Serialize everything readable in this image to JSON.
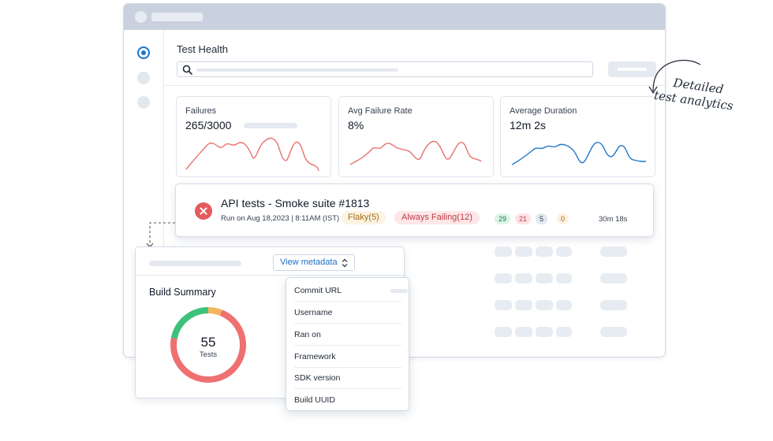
{
  "page": {
    "title": "Test Health"
  },
  "metrics": [
    {
      "label": "Failures",
      "value": "265/3000",
      "color": "#e8716c"
    },
    {
      "label": "Avg Failure Rate",
      "value": "8%",
      "color": "#e8716c"
    },
    {
      "label": "Average Duration",
      "value": "12m 2s",
      "color": "#1f78c8"
    }
  ],
  "run": {
    "title": "API tests - Smoke suite #1813",
    "meta": "Run on Aug 18,2023 | 8:11AM (IST)",
    "flaky": "Flaky(5)",
    "always_failing": "Always Failing(12)",
    "passed": "29",
    "failed": "21",
    "skipped": "5",
    "other": "0",
    "duration": "30m 18s"
  },
  "build": {
    "view_metadata": "View metadata",
    "title": "Build Summary",
    "total": "55",
    "total_label": "Tests",
    "ring": {
      "failed_fraction": 0.72,
      "passed_fraction": 0.22,
      "flaky_fraction": 0.06
    },
    "colors": {
      "failed": "#ee7070",
      "passed": "#3cc27a",
      "flaky": "#f4b45f"
    }
  },
  "metadata_menu": [
    "Commit URL",
    "Username",
    "Ran on",
    "Framework",
    "SDK version",
    "Build UUID"
  ],
  "annotation": {
    "line1": "Detailed",
    "line2": "test analytics"
  }
}
